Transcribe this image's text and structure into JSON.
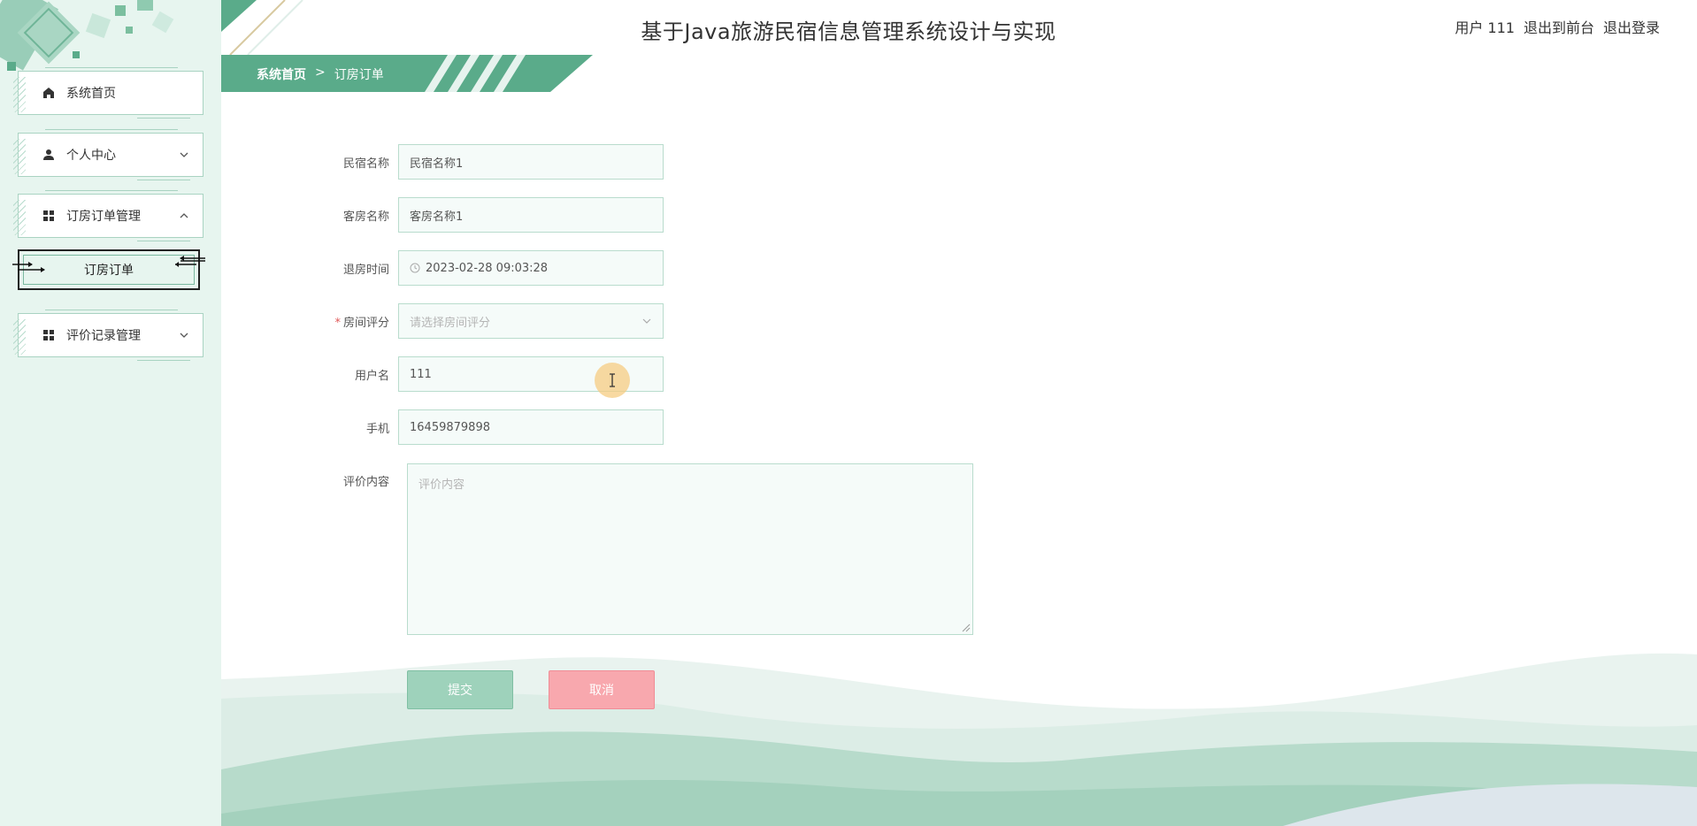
{
  "header": {
    "title": "基于Java旅游民宿信息管理系统设计与实现",
    "user_label": "用户 111",
    "back_to_front": "退出到前台",
    "logout": "退出登录"
  },
  "breadcrumb": {
    "home": "系统首页",
    "separator": ">",
    "current": "订房订单"
  },
  "sidebar": {
    "items": [
      {
        "label": "系统首页",
        "icon": "home-icon"
      },
      {
        "label": "个人中心",
        "icon": "user-icon",
        "expanded": false
      },
      {
        "label": "订房订单管理",
        "icon": "grid-icon",
        "expanded": true
      },
      {
        "label": "评价记录管理",
        "icon": "grid-icon",
        "expanded": false
      }
    ],
    "sub_item": {
      "label": "订房订单"
    }
  },
  "form": {
    "homestay_name": {
      "label": "民宿名称",
      "value": "民宿名称1"
    },
    "room_name": {
      "label": "客房名称",
      "value": "客房名称1"
    },
    "checkout_time": {
      "label": "退房时间",
      "value": "2023-02-28 09:03:28"
    },
    "room_rating": {
      "label": "房间评分",
      "placeholder": "请选择房间评分",
      "required_mark": "*"
    },
    "username": {
      "label": "用户名",
      "value": "111"
    },
    "phone": {
      "label": "手机",
      "value": "16459879898"
    },
    "review": {
      "label": "评价内容",
      "placeholder": "评价内容"
    },
    "submit_label": "提交",
    "cancel_label": "取消"
  },
  "colors": {
    "accent": "#5aab8a",
    "sidebar_bg": "#e7f5ef",
    "field_border": "#b9dccd",
    "cancel": "#f8a8ae",
    "submit": "#9ed2bb"
  }
}
